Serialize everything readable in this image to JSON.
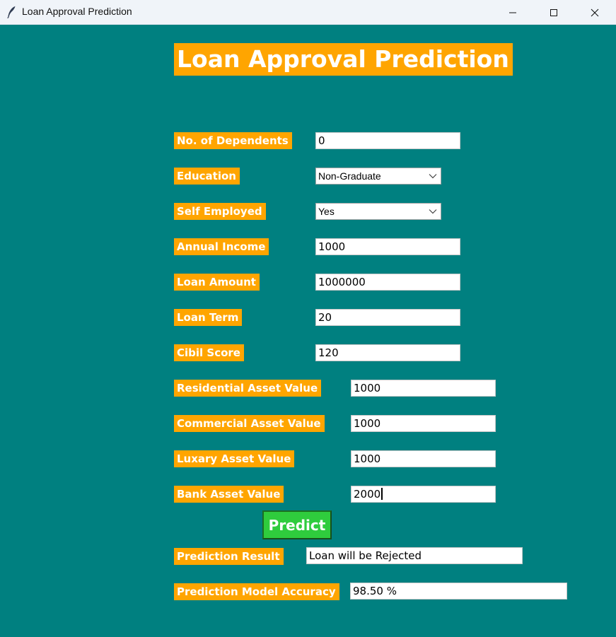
{
  "window": {
    "title": "Loan Approval Prediction",
    "controls": [
      "minimize",
      "maximize",
      "close"
    ]
  },
  "colors": {
    "background": "#008080",
    "label_bg": "#ffa500",
    "label_text": "#ffffff",
    "button_bg": "#2fcc3d"
  },
  "form": {
    "heading": "Loan Approval Prediction",
    "fields": {
      "dependents": {
        "label": "No. of Dependents",
        "value": "0"
      },
      "education": {
        "label": "Education",
        "value": "Non-Graduate"
      },
      "self_employed": {
        "label": "Self Employed",
        "value": "Yes"
      },
      "annual_income": {
        "label": "Annual Income",
        "value": "1000"
      },
      "loan_amount": {
        "label": "Loan Amount",
        "value": "1000000"
      },
      "loan_term": {
        "label": "Loan Term",
        "value": "20"
      },
      "cibil_score": {
        "label": "Cibil Score",
        "value": "120"
      },
      "residential_asset": {
        "label": "Residential Asset Value",
        "value": "1000"
      },
      "commercial_asset": {
        "label": "Commercial Asset Value",
        "value": "1000"
      },
      "luxury_asset": {
        "label": "Luxary Asset Value",
        "value": "1000"
      },
      "bank_asset": {
        "label": "Bank Asset Value",
        "value": "2000"
      }
    },
    "predict_label": "Predict",
    "result": {
      "label": "Prediction Result",
      "value": "Loan will be Rejected"
    },
    "accuracy": {
      "label": "Prediction Model Accuracy",
      "value": "98.50 %"
    }
  }
}
